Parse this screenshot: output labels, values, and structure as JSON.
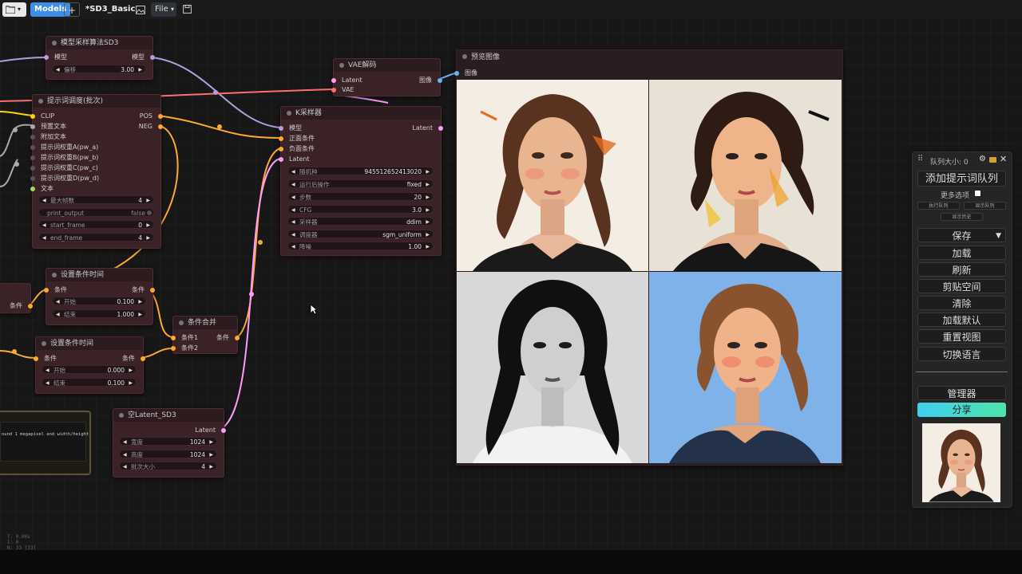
{
  "topbar": {
    "models": "Models",
    "add": "+",
    "title": "*SD3_Basic",
    "file": "File"
  },
  "nodes": {
    "model_sampling": {
      "title": "模型采样算法SD3",
      "in_model": "模型",
      "out_model": "模型",
      "shift_label": "偏移",
      "shift_value": "3.00"
    },
    "vae_decode": {
      "title": "VAE解码",
      "in_latent": "Latent",
      "in_vae": "VAE",
      "out_image": "图像"
    },
    "prompt_schedule": {
      "title": "提示词调度(批次)",
      "inputs": [
        "CLIP",
        "预置文本",
        "附加文本",
        "提示词权重A(pw_a)",
        "提示词权重B(pw_b)",
        "提示词权重C(pw_c)",
        "提示词权重D(pw_d)",
        "文本"
      ],
      "outputs": [
        "POS",
        "NEG"
      ],
      "w_max_frames_label": "最大帧数",
      "w_max_frames_value": "4",
      "w_print_label": "print_output",
      "w_print_value": "false",
      "w_start_label": "start_frame",
      "w_start_value": "0",
      "w_end_label": "end_frame",
      "w_end_value": "4"
    },
    "ksampler": {
      "title": "K采样器",
      "inputs": [
        "模型",
        "正面条件",
        "负面条件",
        "Latent"
      ],
      "out_latent": "Latent",
      "widgets": [
        {
          "label": "随机种",
          "value": "945512652413020"
        },
        {
          "label": "运行后操作",
          "value": "fixed"
        },
        {
          "label": "步数",
          "value": "20"
        },
        {
          "label": "CFG",
          "value": "3.0"
        },
        {
          "label": "采样器",
          "value": "ddim"
        },
        {
          "label": "调度器",
          "value": "sgm_uniform"
        },
        {
          "label": "降噪",
          "value": "1.00"
        }
      ]
    },
    "cond_time_1": {
      "title": "设置条件时间",
      "in": "条件",
      "out": "条件",
      "start_label": "开始",
      "start_value": "0.100",
      "end_label": "结束",
      "end_value": "1.000"
    },
    "cond_time_2": {
      "title": "设置条件时间",
      "in": "条件",
      "out": "条件",
      "start_label": "开始",
      "start_value": "0.000",
      "end_label": "结束",
      "end_value": "0.100"
    },
    "cond_combine": {
      "title": "条件合并",
      "in1": "条件1",
      "in2": "条件2",
      "out": "条件"
    },
    "empty_latent": {
      "title": "空Latent_SD3",
      "out_latent": "Latent",
      "w_width_label": "宽度",
      "w_width_value": "1024",
      "w_height_label": "高度",
      "w_height_value": "1024",
      "w_batch_label": "批次大小",
      "w_batch_value": "4"
    },
    "partial_left": {
      "out": "条件"
    },
    "textbox": {
      "text": "ound 1 megapixel and width/height"
    },
    "preview": {
      "title": "预览图像",
      "in_image": "图像"
    }
  },
  "sidebar": {
    "queue_size": "队列大小: 0",
    "add_queue": "添加提示词队列",
    "more_options": "更多选项",
    "exec_queue": "执行队列",
    "show_queue": "显示队列",
    "show_history": "显示历史",
    "save": "保存",
    "load": "加载",
    "refresh": "刷新",
    "clipspace": "剪贴空间",
    "clear": "清除",
    "load_default": "加载默认",
    "reset_view": "重置视图",
    "switch_lang": "切换语言",
    "manager": "管理器",
    "share": "分享"
  },
  "stats": {
    "line1": "T: 0.00s",
    "line2": "I: 0",
    "line3": "N: 33 [33]"
  },
  "colors": {
    "clip": "#ffd500",
    "conditioning": "#ffa931",
    "model": "#b39ddb",
    "latent": "#ff9cf9",
    "image": "#64b5f6",
    "vae": "#ff6e6e",
    "share_gradient": "#3fd0f0-#4fe3a8"
  }
}
